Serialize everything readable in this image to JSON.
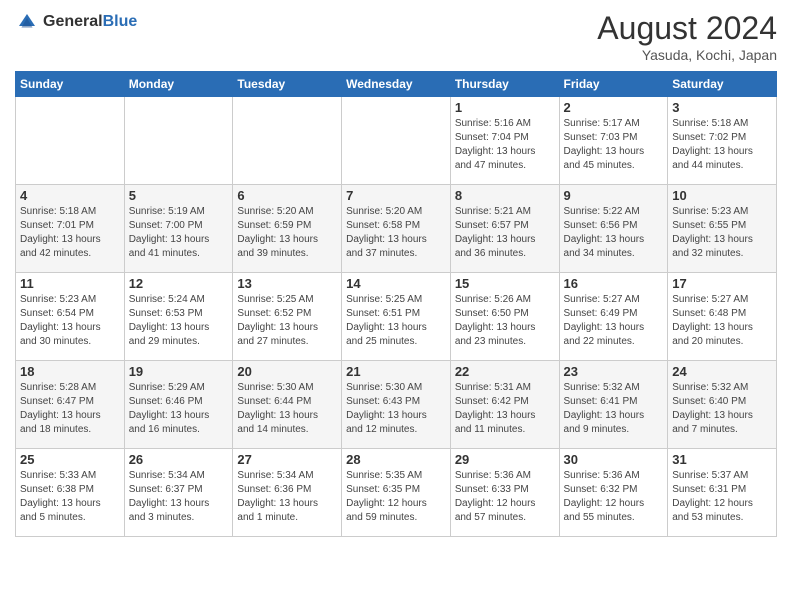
{
  "header": {
    "logo_general": "General",
    "logo_blue": "Blue",
    "month_title": "August 2024",
    "location": "Yasuda, Kochi, Japan"
  },
  "days_of_week": [
    "Sunday",
    "Monday",
    "Tuesday",
    "Wednesday",
    "Thursday",
    "Friday",
    "Saturday"
  ],
  "weeks": [
    [
      {
        "day": "",
        "info": ""
      },
      {
        "day": "",
        "info": ""
      },
      {
        "day": "",
        "info": ""
      },
      {
        "day": "",
        "info": ""
      },
      {
        "day": "1",
        "info": "Sunrise: 5:16 AM\nSunset: 7:04 PM\nDaylight: 13 hours\nand 47 minutes."
      },
      {
        "day": "2",
        "info": "Sunrise: 5:17 AM\nSunset: 7:03 PM\nDaylight: 13 hours\nand 45 minutes."
      },
      {
        "day": "3",
        "info": "Sunrise: 5:18 AM\nSunset: 7:02 PM\nDaylight: 13 hours\nand 44 minutes."
      }
    ],
    [
      {
        "day": "4",
        "info": "Sunrise: 5:18 AM\nSunset: 7:01 PM\nDaylight: 13 hours\nand 42 minutes."
      },
      {
        "day": "5",
        "info": "Sunrise: 5:19 AM\nSunset: 7:00 PM\nDaylight: 13 hours\nand 41 minutes."
      },
      {
        "day": "6",
        "info": "Sunrise: 5:20 AM\nSunset: 6:59 PM\nDaylight: 13 hours\nand 39 minutes."
      },
      {
        "day": "7",
        "info": "Sunrise: 5:20 AM\nSunset: 6:58 PM\nDaylight: 13 hours\nand 37 minutes."
      },
      {
        "day": "8",
        "info": "Sunrise: 5:21 AM\nSunset: 6:57 PM\nDaylight: 13 hours\nand 36 minutes."
      },
      {
        "day": "9",
        "info": "Sunrise: 5:22 AM\nSunset: 6:56 PM\nDaylight: 13 hours\nand 34 minutes."
      },
      {
        "day": "10",
        "info": "Sunrise: 5:23 AM\nSunset: 6:55 PM\nDaylight: 13 hours\nand 32 minutes."
      }
    ],
    [
      {
        "day": "11",
        "info": "Sunrise: 5:23 AM\nSunset: 6:54 PM\nDaylight: 13 hours\nand 30 minutes."
      },
      {
        "day": "12",
        "info": "Sunrise: 5:24 AM\nSunset: 6:53 PM\nDaylight: 13 hours\nand 29 minutes."
      },
      {
        "day": "13",
        "info": "Sunrise: 5:25 AM\nSunset: 6:52 PM\nDaylight: 13 hours\nand 27 minutes."
      },
      {
        "day": "14",
        "info": "Sunrise: 5:25 AM\nSunset: 6:51 PM\nDaylight: 13 hours\nand 25 minutes."
      },
      {
        "day": "15",
        "info": "Sunrise: 5:26 AM\nSunset: 6:50 PM\nDaylight: 13 hours\nand 23 minutes."
      },
      {
        "day": "16",
        "info": "Sunrise: 5:27 AM\nSunset: 6:49 PM\nDaylight: 13 hours\nand 22 minutes."
      },
      {
        "day": "17",
        "info": "Sunrise: 5:27 AM\nSunset: 6:48 PM\nDaylight: 13 hours\nand 20 minutes."
      }
    ],
    [
      {
        "day": "18",
        "info": "Sunrise: 5:28 AM\nSunset: 6:47 PM\nDaylight: 13 hours\nand 18 minutes."
      },
      {
        "day": "19",
        "info": "Sunrise: 5:29 AM\nSunset: 6:46 PM\nDaylight: 13 hours\nand 16 minutes."
      },
      {
        "day": "20",
        "info": "Sunrise: 5:30 AM\nSunset: 6:44 PM\nDaylight: 13 hours\nand 14 minutes."
      },
      {
        "day": "21",
        "info": "Sunrise: 5:30 AM\nSunset: 6:43 PM\nDaylight: 13 hours\nand 12 minutes."
      },
      {
        "day": "22",
        "info": "Sunrise: 5:31 AM\nSunset: 6:42 PM\nDaylight: 13 hours\nand 11 minutes."
      },
      {
        "day": "23",
        "info": "Sunrise: 5:32 AM\nSunset: 6:41 PM\nDaylight: 13 hours\nand 9 minutes."
      },
      {
        "day": "24",
        "info": "Sunrise: 5:32 AM\nSunset: 6:40 PM\nDaylight: 13 hours\nand 7 minutes."
      }
    ],
    [
      {
        "day": "25",
        "info": "Sunrise: 5:33 AM\nSunset: 6:38 PM\nDaylight: 13 hours\nand 5 minutes."
      },
      {
        "day": "26",
        "info": "Sunrise: 5:34 AM\nSunset: 6:37 PM\nDaylight: 13 hours\nand 3 minutes."
      },
      {
        "day": "27",
        "info": "Sunrise: 5:34 AM\nSunset: 6:36 PM\nDaylight: 13 hours\nand 1 minute."
      },
      {
        "day": "28",
        "info": "Sunrise: 5:35 AM\nSunset: 6:35 PM\nDaylight: 12 hours\nand 59 minutes."
      },
      {
        "day": "29",
        "info": "Sunrise: 5:36 AM\nSunset: 6:33 PM\nDaylight: 12 hours\nand 57 minutes."
      },
      {
        "day": "30",
        "info": "Sunrise: 5:36 AM\nSunset: 6:32 PM\nDaylight: 12 hours\nand 55 minutes."
      },
      {
        "day": "31",
        "info": "Sunrise: 5:37 AM\nSunset: 6:31 PM\nDaylight: 12 hours\nand 53 minutes."
      }
    ]
  ]
}
